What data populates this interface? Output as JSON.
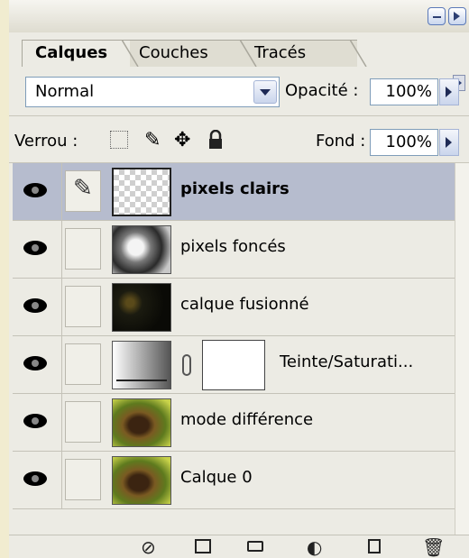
{
  "tabs": [
    "Calques",
    "Couches",
    "Tracés"
  ],
  "blend_mode": "Normal",
  "opacity_label": "Opacité :",
  "opacity_value": "100%",
  "lock_label": "Verrou :",
  "fill_label": "Fond :",
  "fill_value": "100%",
  "lock_icons": [
    "lock-transparency-icon",
    "lock-pixels-brush-icon",
    "lock-position-move-icon",
    "lock-all-padlock-icon"
  ],
  "layers": [
    {
      "name": "pixels clairs",
      "selected": true,
      "thumbnail": "checker"
    },
    {
      "name": "pixels foncés",
      "selected": false,
      "thumbnail": "grayscale-horse"
    },
    {
      "name": "calque fusionné",
      "selected": false,
      "thumbnail": "dark"
    },
    {
      "name": "Teinte/Saturati...",
      "selected": false,
      "thumbnail": "adjustment-gradient",
      "has_mask": true
    },
    {
      "name": "mode différence",
      "selected": false,
      "thumbnail": "horse"
    },
    {
      "name": "Calque 0",
      "selected": false,
      "thumbnail": "horse"
    }
  ],
  "bottom_toolbar": [
    "link-layers-icon",
    "layer-style-fx-icon",
    "add-mask-icon",
    "new-group-folder-icon",
    "adjustment-layer-icon",
    "new-layer-icon",
    "trash-icon"
  ],
  "colors": {
    "selected_row": "#b6bcce",
    "panel_bg": "#ecebe4",
    "page_bg": "#f1ecd0"
  }
}
